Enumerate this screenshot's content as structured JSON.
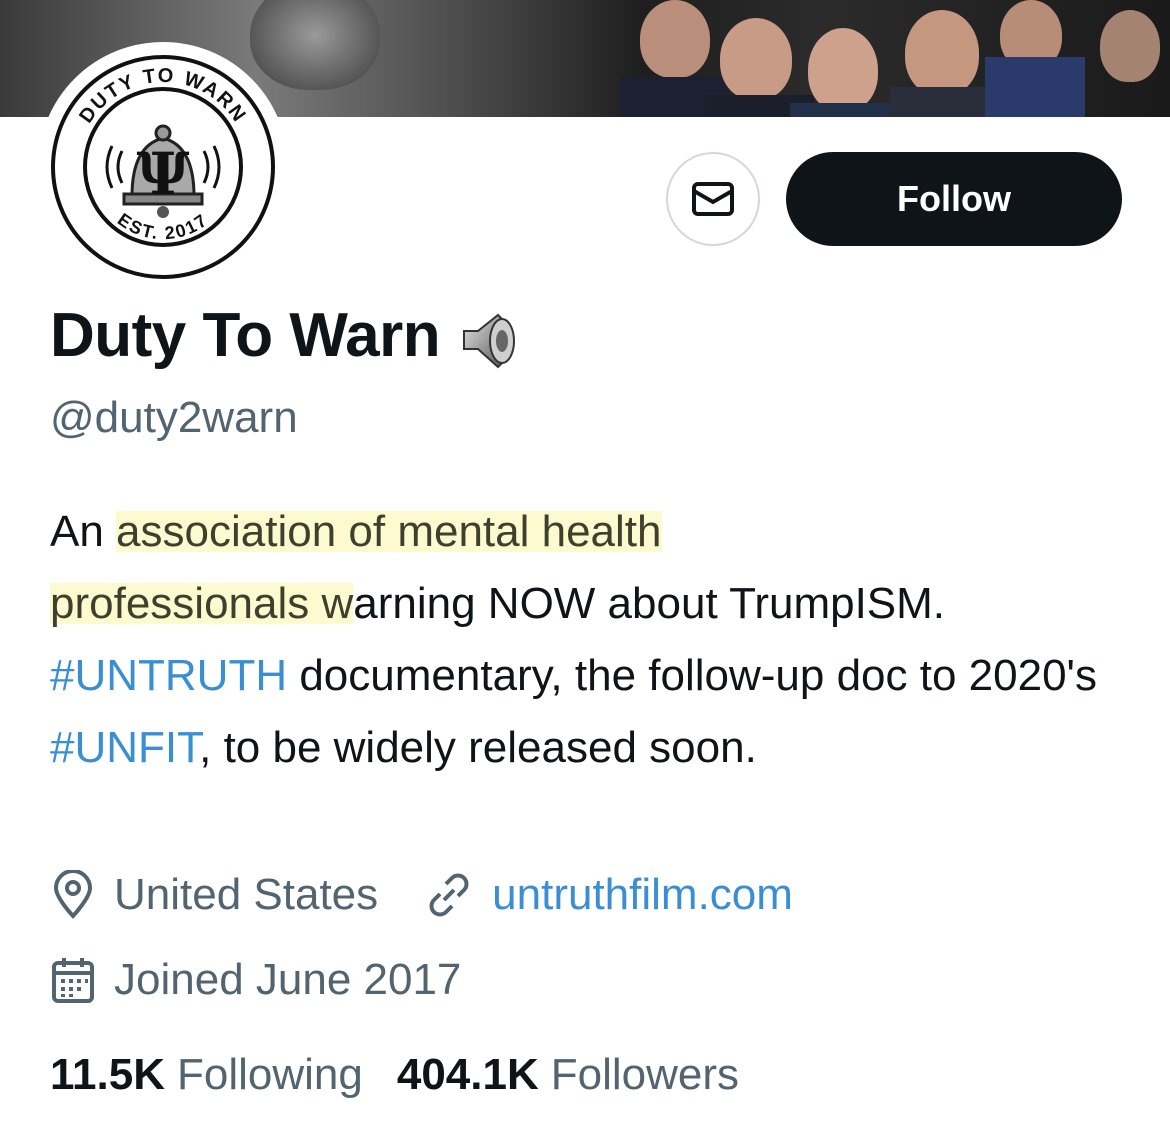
{
  "profile": {
    "display_name": "Duty To Warn",
    "name_emoji": "speaker-icon",
    "handle": "@duty2warn",
    "follow_label": "Follow",
    "avatar_text_top": "DUTY TO WARN",
    "avatar_text_bottom": "EST. 2017"
  },
  "bio": {
    "part1": "An ",
    "highlight1": "association of mental health",
    "part2": " ",
    "highlight2": "professionals w",
    "part3": "arning NOW about TrumpISM. ",
    "hashtag1": "#UNTRUTH",
    "part4": " documentary, the follow-up doc to 2020's ",
    "hashtag2": "#UNFIT",
    "part5": ", to be widely released soon."
  },
  "meta": {
    "location": "United States",
    "website": "untruthfilm.com",
    "joined": "Joined June 2017"
  },
  "stats": {
    "following_count": "11.5K",
    "following_label": "Following",
    "followers_count": "404.1K",
    "followers_label": "Followers"
  },
  "colors": {
    "link": "#3a8fd4",
    "secondary_text": "#536471",
    "primary_text": "#0f1419",
    "highlight": "#fdfacd",
    "follow_button": "#0f1419"
  }
}
